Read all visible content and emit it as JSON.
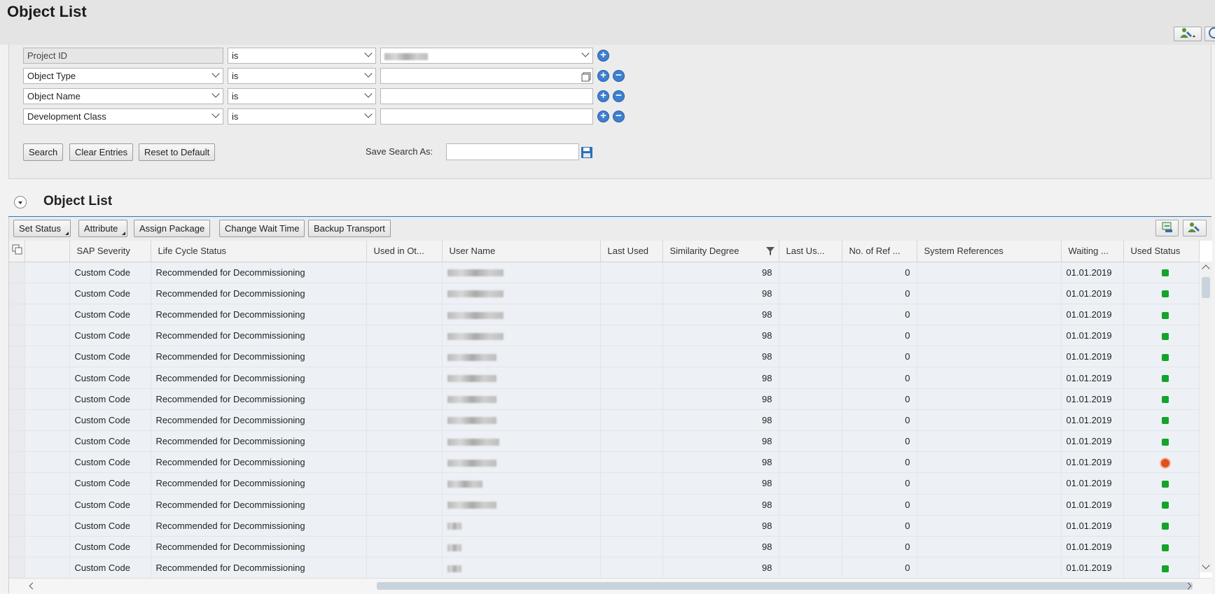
{
  "window": {
    "title": "Object List"
  },
  "filters": [
    {
      "field": "Project ID",
      "operator": "is",
      "value": "██████",
      "buttons": [
        "add"
      ]
    },
    {
      "field": "Object Type",
      "operator": "is",
      "value": "",
      "buttons": [
        "add",
        "remove"
      ]
    },
    {
      "field": "Object Name",
      "operator": "is",
      "value": "",
      "buttons": [
        "add",
        "remove"
      ]
    },
    {
      "field": "Development Class",
      "operator": "is",
      "value": "",
      "buttons": [
        "add",
        "remove"
      ]
    }
  ],
  "search_buttons": {
    "search": "Search",
    "clear": "Clear Entries",
    "reset": "Reset to Default"
  },
  "save_search": {
    "label": "Save Search As:",
    "value": ""
  },
  "section": {
    "title": "Object List"
  },
  "toolbar": {
    "set_status": "Set Status",
    "attribute": "Attribute",
    "assign_package": "Assign Package",
    "change_wait_time": "Change Wait Time",
    "backup_transport": "Backup Transport"
  },
  "columns": [
    "SAP Severity",
    "Life Cycle Status",
    "Used in Ot...",
    "User Name",
    "Last Used",
    "Similarity Degree",
    "Last Us...",
    "No. of Ref ...",
    "System References",
    "Waiting ...",
    "Used Status"
  ],
  "rows": [
    {
      "severity": "Custom Code",
      "lifecycle": "Recommended for Decommissioning",
      "used_in_other": "",
      "user_blur_width": 80,
      "last_used": "",
      "similarity": "98",
      "last_us": "",
      "refs": "0",
      "sys_refs": "",
      "waiting": "01.01.2019",
      "status": "green"
    },
    {
      "severity": "Custom Code",
      "lifecycle": "Recommended for Decommissioning",
      "used_in_other": "",
      "user_blur_width": 80,
      "last_used": "",
      "similarity": "98",
      "last_us": "",
      "refs": "0",
      "sys_refs": "",
      "waiting": "01.01.2019",
      "status": "green"
    },
    {
      "severity": "Custom Code",
      "lifecycle": "Recommended for Decommissioning",
      "used_in_other": "",
      "user_blur_width": 80,
      "last_used": "",
      "similarity": "98",
      "last_us": "",
      "refs": "0",
      "sys_refs": "",
      "waiting": "01.01.2019",
      "status": "green"
    },
    {
      "severity": "Custom Code",
      "lifecycle": "Recommended for Decommissioning",
      "used_in_other": "",
      "user_blur_width": 80,
      "last_used": "",
      "similarity": "98",
      "last_us": "",
      "refs": "0",
      "sys_refs": "",
      "waiting": "01.01.2019",
      "status": "green"
    },
    {
      "severity": "Custom Code",
      "lifecycle": "Recommended for Decommissioning",
      "used_in_other": "",
      "user_blur_width": 70,
      "last_used": "",
      "similarity": "98",
      "last_us": "",
      "refs": "0",
      "sys_refs": "",
      "waiting": "01.01.2019",
      "status": "green"
    },
    {
      "severity": "Custom Code",
      "lifecycle": "Recommended for Decommissioning",
      "used_in_other": "",
      "user_blur_width": 70,
      "last_used": "",
      "similarity": "98",
      "last_us": "",
      "refs": "0",
      "sys_refs": "",
      "waiting": "01.01.2019",
      "status": "green"
    },
    {
      "severity": "Custom Code",
      "lifecycle": "Recommended for Decommissioning",
      "used_in_other": "",
      "user_blur_width": 70,
      "last_used": "",
      "similarity": "98",
      "last_us": "",
      "refs": "0",
      "sys_refs": "",
      "waiting": "01.01.2019",
      "status": "green"
    },
    {
      "severity": "Custom Code",
      "lifecycle": "Recommended for Decommissioning",
      "used_in_other": "",
      "user_blur_width": 70,
      "last_used": "",
      "similarity": "98",
      "last_us": "",
      "refs": "0",
      "sys_refs": "",
      "waiting": "01.01.2019",
      "status": "green"
    },
    {
      "severity": "Custom Code",
      "lifecycle": "Recommended for Decommissioning",
      "used_in_other": "",
      "user_blur_width": 74,
      "last_used": "",
      "similarity": "98",
      "last_us": "",
      "refs": "0",
      "sys_refs": "",
      "waiting": "01.01.2019",
      "status": "green"
    },
    {
      "severity": "Custom Code",
      "lifecycle": "Recommended for Decommissioning",
      "used_in_other": "",
      "user_blur_width": 70,
      "last_used": "",
      "similarity": "98",
      "last_us": "",
      "refs": "0",
      "sys_refs": "",
      "waiting": "01.01.2019",
      "status": "red"
    },
    {
      "severity": "Custom Code",
      "lifecycle": "Recommended for Decommissioning",
      "used_in_other": "",
      "user_blur_width": 50,
      "last_used": "",
      "similarity": "98",
      "last_us": "",
      "refs": "0",
      "sys_refs": "",
      "waiting": "01.01.2019",
      "status": "green"
    },
    {
      "severity": "Custom Code",
      "lifecycle": "Recommended for Decommissioning",
      "used_in_other": "",
      "user_blur_width": 70,
      "last_used": "",
      "similarity": "98",
      "last_us": "",
      "refs": "0",
      "sys_refs": "",
      "waiting": "01.01.2019",
      "status": "green"
    },
    {
      "severity": "Custom Code",
      "lifecycle": "Recommended for Decommissioning",
      "used_in_other": "",
      "user_blur_width": 20,
      "last_used": "",
      "similarity": "98",
      "last_us": "",
      "refs": "0",
      "sys_refs": "",
      "waiting": "01.01.2019",
      "status": "green"
    },
    {
      "severity": "Custom Code",
      "lifecycle": "Recommended for Decommissioning",
      "used_in_other": "",
      "user_blur_width": 20,
      "last_used": "",
      "similarity": "98",
      "last_us": "",
      "refs": "0",
      "sys_refs": "",
      "waiting": "01.01.2019",
      "status": "green"
    },
    {
      "severity": "Custom Code",
      "lifecycle": "Recommended for Decommissioning",
      "used_in_other": "",
      "user_blur_width": 20,
      "last_used": "",
      "similarity": "98",
      "last_us": "",
      "refs": "0",
      "sys_refs": "",
      "waiting": "01.01.2019",
      "status": "green"
    }
  ],
  "colors": {
    "accent_line": "#2b7bb9",
    "status_green": "#15a32a",
    "status_red": "#e0501e",
    "add_button": "#3f7fd0"
  },
  "icons": {
    "personalize": "person-wrench-icon",
    "export": "export-icon",
    "save_search": "floppy-disk-icon",
    "value_help": "value-help-icon",
    "filter": "filter-icon",
    "select_all": "select-all-icon"
  }
}
